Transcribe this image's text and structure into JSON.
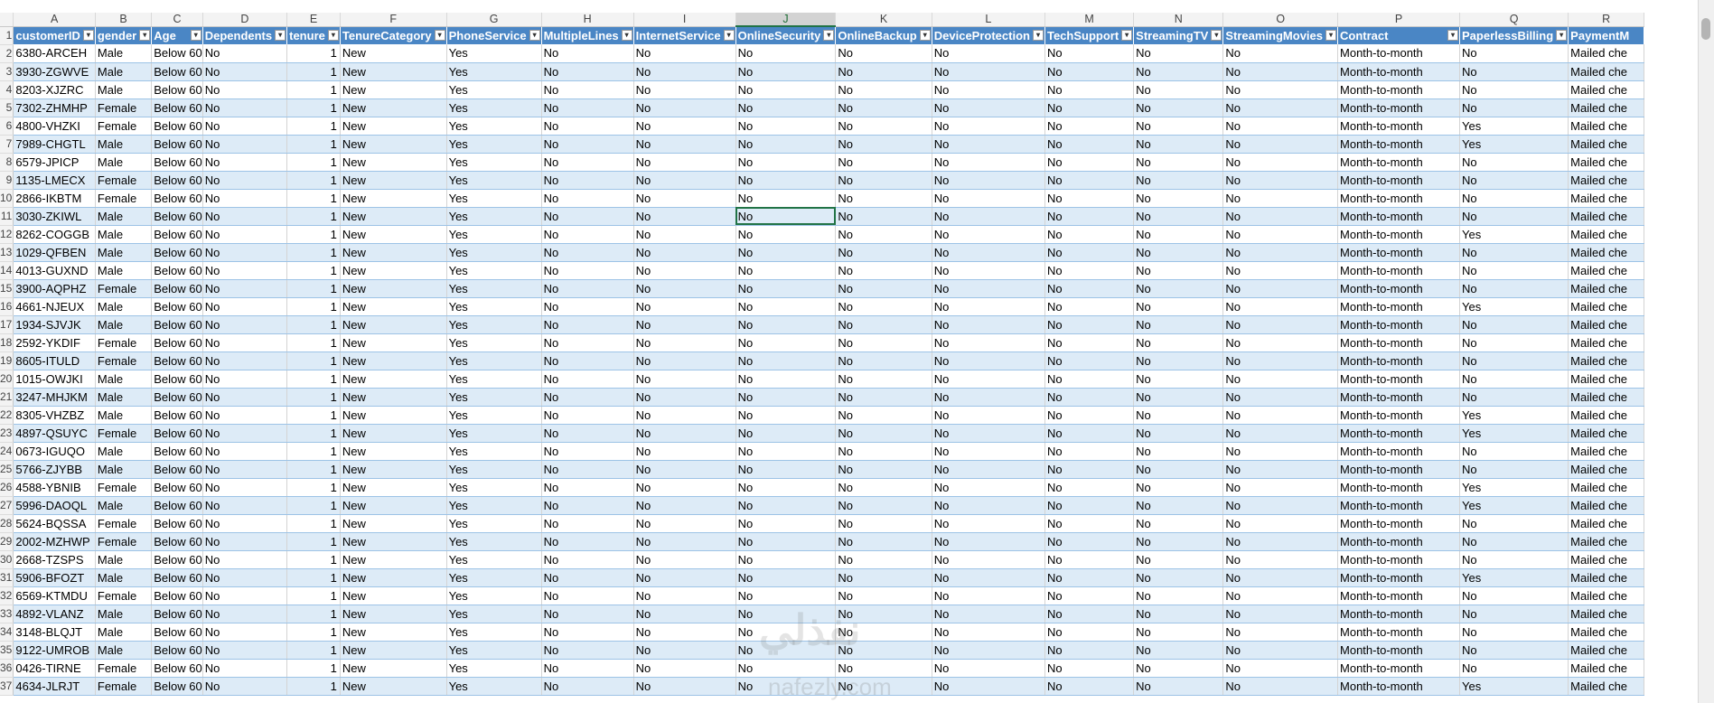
{
  "columns": [
    "A",
    "B",
    "C",
    "D",
    "E",
    "F",
    "G",
    "H",
    "I",
    "J",
    "K",
    "L",
    "M",
    "N",
    "O",
    "P",
    "Q",
    "R"
  ],
  "headers": [
    "customerID",
    "gender",
    "Age",
    "Dependents",
    "tenure",
    "TenureCategory",
    "PhoneService",
    "MultipleLines",
    "InternetService",
    "OnlineSecurity",
    "OnlineBackup",
    "DeviceProtection",
    "TechSupport",
    "StreamingTV",
    "StreamingMovies",
    "Contract",
    "PaperlessBilling",
    "PaymentM"
  ],
  "selected_column": "J",
  "header_row_number": "1",
  "first_data_row_number": 2,
  "watermark": {
    "arabic": "نفذلي",
    "latin": "nafezly.com"
  },
  "rows": [
    [
      "6380-ARCEH",
      "Male",
      "Below 60",
      "No",
      "1",
      "New",
      "Yes",
      "No",
      "No",
      "No",
      "No",
      "No",
      "No",
      "No",
      "No",
      "Month-to-month",
      "No",
      "Mailed che"
    ],
    [
      "3930-ZGWVE",
      "Male",
      "Below 60",
      "No",
      "1",
      "New",
      "Yes",
      "No",
      "No",
      "No",
      "No",
      "No",
      "No",
      "No",
      "No",
      "Month-to-month",
      "No",
      "Mailed che"
    ],
    [
      "8203-XJZRC",
      "Male",
      "Below 60",
      "No",
      "1",
      "New",
      "Yes",
      "No",
      "No",
      "No",
      "No",
      "No",
      "No",
      "No",
      "No",
      "Month-to-month",
      "No",
      "Mailed che"
    ],
    [
      "7302-ZHMHP",
      "Female",
      "Below 60",
      "No",
      "1",
      "New",
      "Yes",
      "No",
      "No",
      "No",
      "No",
      "No",
      "No",
      "No",
      "No",
      "Month-to-month",
      "No",
      "Mailed che"
    ],
    [
      "4800-VHZKI",
      "Female",
      "Below 60",
      "No",
      "1",
      "New",
      "Yes",
      "No",
      "No",
      "No",
      "No",
      "No",
      "No",
      "No",
      "No",
      "Month-to-month",
      "Yes",
      "Mailed che"
    ],
    [
      "7989-CHGTL",
      "Male",
      "Below 60",
      "No",
      "1",
      "New",
      "Yes",
      "No",
      "No",
      "No",
      "No",
      "No",
      "No",
      "No",
      "No",
      "Month-to-month",
      "Yes",
      "Mailed che"
    ],
    [
      "6579-JPICP",
      "Male",
      "Below 60",
      "No",
      "1",
      "New",
      "Yes",
      "No",
      "No",
      "No",
      "No",
      "No",
      "No",
      "No",
      "No",
      "Month-to-month",
      "No",
      "Mailed che"
    ],
    [
      "1135-LMECX",
      "Female",
      "Below 60",
      "No",
      "1",
      "New",
      "Yes",
      "No",
      "No",
      "No",
      "No",
      "No",
      "No",
      "No",
      "No",
      "Month-to-month",
      "No",
      "Mailed che"
    ],
    [
      "2866-IKBTM",
      "Female",
      "Below 60",
      "No",
      "1",
      "New",
      "Yes",
      "No",
      "No",
      "No",
      "No",
      "No",
      "No",
      "No",
      "No",
      "Month-to-month",
      "No",
      "Mailed che"
    ],
    [
      "3030-ZKIWL",
      "Male",
      "Below 60",
      "No",
      "1",
      "New",
      "Yes",
      "No",
      "No",
      "No",
      "No",
      "No",
      "No",
      "No",
      "No",
      "Month-to-month",
      "No",
      "Mailed che"
    ],
    [
      "8262-COGGB",
      "Male",
      "Below 60",
      "No",
      "1",
      "New",
      "Yes",
      "No",
      "No",
      "No",
      "No",
      "No",
      "No",
      "No",
      "No",
      "Month-to-month",
      "Yes",
      "Mailed che"
    ],
    [
      "1029-QFBEN",
      "Male",
      "Below 60",
      "No",
      "1",
      "New",
      "Yes",
      "No",
      "No",
      "No",
      "No",
      "No",
      "No",
      "No",
      "No",
      "Month-to-month",
      "No",
      "Mailed che"
    ],
    [
      "4013-GUXND",
      "Male",
      "Below 60",
      "No",
      "1",
      "New",
      "Yes",
      "No",
      "No",
      "No",
      "No",
      "No",
      "No",
      "No",
      "No",
      "Month-to-month",
      "No",
      "Mailed che"
    ],
    [
      "3900-AQPHZ",
      "Female",
      "Below 60",
      "No",
      "1",
      "New",
      "Yes",
      "No",
      "No",
      "No",
      "No",
      "No",
      "No",
      "No",
      "No",
      "Month-to-month",
      "No",
      "Mailed che"
    ],
    [
      "4661-NJEUX",
      "Male",
      "Below 60",
      "No",
      "1",
      "New",
      "Yes",
      "No",
      "No",
      "No",
      "No",
      "No",
      "No",
      "No",
      "No",
      "Month-to-month",
      "Yes",
      "Mailed che"
    ],
    [
      "1934-SJVJK",
      "Male",
      "Below 60",
      "No",
      "1",
      "New",
      "Yes",
      "No",
      "No",
      "No",
      "No",
      "No",
      "No",
      "No",
      "No",
      "Month-to-month",
      "No",
      "Mailed che"
    ],
    [
      "2592-YKDIF",
      "Female",
      "Below 60",
      "No",
      "1",
      "New",
      "Yes",
      "No",
      "No",
      "No",
      "No",
      "No",
      "No",
      "No",
      "No",
      "Month-to-month",
      "No",
      "Mailed che"
    ],
    [
      "8605-ITULD",
      "Female",
      "Below 60",
      "No",
      "1",
      "New",
      "Yes",
      "No",
      "No",
      "No",
      "No",
      "No",
      "No",
      "No",
      "No",
      "Month-to-month",
      "No",
      "Mailed che"
    ],
    [
      "1015-OWJKI",
      "Male",
      "Below 60",
      "No",
      "1",
      "New",
      "Yes",
      "No",
      "No",
      "No",
      "No",
      "No",
      "No",
      "No",
      "No",
      "Month-to-month",
      "No",
      "Mailed che"
    ],
    [
      "3247-MHJKM",
      "Male",
      "Below 60",
      "No",
      "1",
      "New",
      "Yes",
      "No",
      "No",
      "No",
      "No",
      "No",
      "No",
      "No",
      "No",
      "Month-to-month",
      "No",
      "Mailed che"
    ],
    [
      "8305-VHZBZ",
      "Male",
      "Below 60",
      "No",
      "1",
      "New",
      "Yes",
      "No",
      "No",
      "No",
      "No",
      "No",
      "No",
      "No",
      "No",
      "Month-to-month",
      "Yes",
      "Mailed che"
    ],
    [
      "4897-QSUYC",
      "Female",
      "Below 60",
      "No",
      "1",
      "New",
      "Yes",
      "No",
      "No",
      "No",
      "No",
      "No",
      "No",
      "No",
      "No",
      "Month-to-month",
      "Yes",
      "Mailed che"
    ],
    [
      "0673-IGUQO",
      "Male",
      "Below 60",
      "No",
      "1",
      "New",
      "Yes",
      "No",
      "No",
      "No",
      "No",
      "No",
      "No",
      "No",
      "No",
      "Month-to-month",
      "No",
      "Mailed che"
    ],
    [
      "5766-ZJYBB",
      "Male",
      "Below 60",
      "No",
      "1",
      "New",
      "Yes",
      "No",
      "No",
      "No",
      "No",
      "No",
      "No",
      "No",
      "No",
      "Month-to-month",
      "No",
      "Mailed che"
    ],
    [
      "4588-YBNIB",
      "Female",
      "Below 60",
      "No",
      "1",
      "New",
      "Yes",
      "No",
      "No",
      "No",
      "No",
      "No",
      "No",
      "No",
      "No",
      "Month-to-month",
      "Yes",
      "Mailed che"
    ],
    [
      "5996-DAOQL",
      "Male",
      "Below 60",
      "No",
      "1",
      "New",
      "Yes",
      "No",
      "No",
      "No",
      "No",
      "No",
      "No",
      "No",
      "No",
      "Month-to-month",
      "Yes",
      "Mailed che"
    ],
    [
      "5624-BQSSA",
      "Female",
      "Below 60",
      "No",
      "1",
      "New",
      "Yes",
      "No",
      "No",
      "No",
      "No",
      "No",
      "No",
      "No",
      "No",
      "Month-to-month",
      "No",
      "Mailed che"
    ],
    [
      "2002-MZHWP",
      "Female",
      "Below 60",
      "No",
      "1",
      "New",
      "Yes",
      "No",
      "No",
      "No",
      "No",
      "No",
      "No",
      "No",
      "No",
      "Month-to-month",
      "No",
      "Mailed che"
    ],
    [
      "2668-TZSPS",
      "Male",
      "Below 60",
      "No",
      "1",
      "New",
      "Yes",
      "No",
      "No",
      "No",
      "No",
      "No",
      "No",
      "No",
      "No",
      "Month-to-month",
      "No",
      "Mailed che"
    ],
    [
      "5906-BFOZT",
      "Male",
      "Below 60",
      "No",
      "1",
      "New",
      "Yes",
      "No",
      "No",
      "No",
      "No",
      "No",
      "No",
      "No",
      "No",
      "Month-to-month",
      "Yes",
      "Mailed che"
    ],
    [
      "6569-KTMDU",
      "Female",
      "Below 60",
      "No",
      "1",
      "New",
      "Yes",
      "No",
      "No",
      "No",
      "No",
      "No",
      "No",
      "No",
      "No",
      "Month-to-month",
      "No",
      "Mailed che"
    ],
    [
      "4892-VLANZ",
      "Male",
      "Below 60",
      "No",
      "1",
      "New",
      "Yes",
      "No",
      "No",
      "No",
      "No",
      "No",
      "No",
      "No",
      "No",
      "Month-to-month",
      "No",
      "Mailed che"
    ],
    [
      "3148-BLQJT",
      "Male",
      "Below 60",
      "No",
      "1",
      "New",
      "Yes",
      "No",
      "No",
      "No",
      "No",
      "No",
      "No",
      "No",
      "No",
      "Month-to-month",
      "No",
      "Mailed che"
    ],
    [
      "9122-UMROB",
      "Male",
      "Below 60",
      "No",
      "1",
      "New",
      "Yes",
      "No",
      "No",
      "No",
      "No",
      "No",
      "No",
      "No",
      "No",
      "Month-to-month",
      "No",
      "Mailed che"
    ],
    [
      "0426-TIRNE",
      "Female",
      "Below 60",
      "No",
      "1",
      "New",
      "Yes",
      "No",
      "No",
      "No",
      "No",
      "No",
      "No",
      "No",
      "No",
      "Month-to-month",
      "No",
      "Mailed che"
    ],
    [
      "4634-JLRJT",
      "Female",
      "Below 60",
      "No",
      "1",
      "New",
      "Yes",
      "No",
      "No",
      "No",
      "No",
      "No",
      "No",
      "No",
      "No",
      "Month-to-month",
      "Yes",
      "Mailed che"
    ]
  ]
}
